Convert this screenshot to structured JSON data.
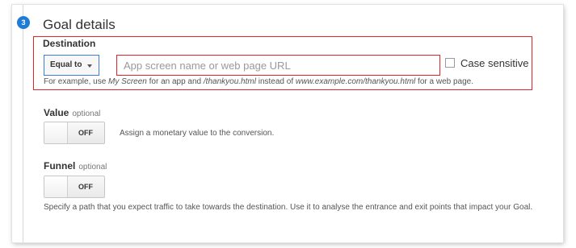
{
  "section": {
    "step_number": "3",
    "title": "Goal details"
  },
  "destination": {
    "label": "Destination",
    "match_type": "Equal to",
    "input_placeholder": "App screen name or web page URL",
    "input_value": "",
    "case_sensitive_label": "Case sensitive",
    "case_sensitive_checked": false,
    "help": {
      "p1": "For example, use ",
      "e1": "My Screen",
      "p2": " for an app and ",
      "e2": "/thankyou.html",
      "p3": " instead of ",
      "e3": "www.example.com/thankyou.html",
      "p4": " for a web page."
    }
  },
  "value": {
    "label": "Value",
    "optional": "optional",
    "toggle_state": "OFF",
    "description": "Assign a monetary value to the conversion."
  },
  "funnel": {
    "label": "Funnel",
    "optional": "optional",
    "toggle_state": "OFF",
    "description": "Specify a path that you expect traffic to take towards the destination. Use it to analyse the entrance and exit points that impact your Goal."
  },
  "colors": {
    "accent_blue": "#1e7bd6",
    "highlight_red": "#e2232a",
    "text": "#333333"
  }
}
